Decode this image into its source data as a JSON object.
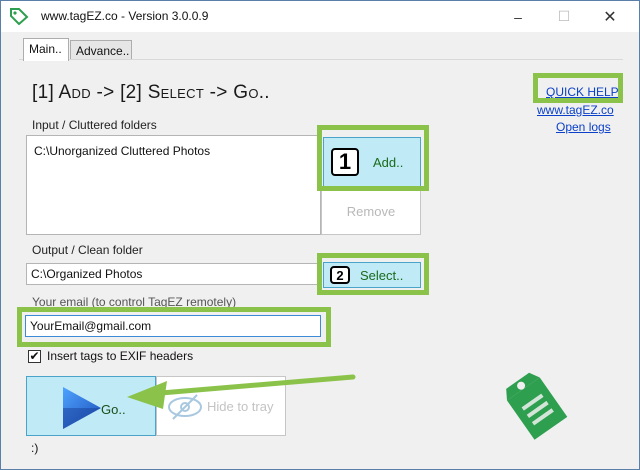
{
  "window": {
    "title": "www.tagEZ.co - Version 3.0.0.9",
    "controls": {
      "minimize": "–",
      "maximize": "☐",
      "close": "✕"
    }
  },
  "tabs": [
    {
      "label": "Main..",
      "active": true
    },
    {
      "label": "Advance..",
      "active": false
    }
  ],
  "heading": "[1] Add -> [2] Select -> Go..",
  "links": {
    "quick_help": "QUICK HELP",
    "website": "www.tagEZ.co",
    "open_logs": "Open logs"
  },
  "input_section": {
    "label": "Input / Cluttered folders",
    "folders": [
      "C:\\Unorganized Cluttered Photos"
    ],
    "add_step": "1",
    "add_label": "Add..",
    "remove_label": "Remove"
  },
  "output_section": {
    "label": "Output / Clean folder",
    "value": "C:\\Organized Photos",
    "select_step": "2",
    "select_label": "Select.."
  },
  "email_section": {
    "label": "Your email (to control TagEZ remotely)",
    "value": "YourEmail@gmail.com"
  },
  "exif_option": {
    "label": "Insert tags to EXIF headers",
    "checked": true,
    "check_glyph": "✔"
  },
  "actions": {
    "go_label": "Go..",
    "hide_label": "Hide to tray"
  },
  "status": ":)",
  "colors": {
    "highlight": "#8bc34a",
    "button_accent_bg": "#bfeaf6",
    "logo_green": "#2e9e4f",
    "link": "#0b40c8"
  },
  "icons": {
    "app": "tag-icon",
    "go": "play-icon",
    "hide": "hidden-eye-icon",
    "logo": "price-tag-logo"
  }
}
